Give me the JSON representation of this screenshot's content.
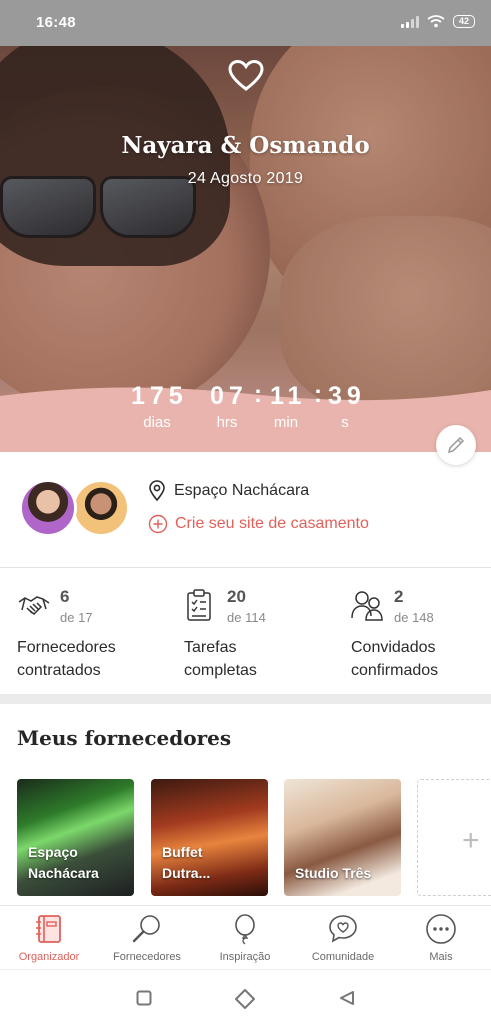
{
  "status_bar": {
    "time": "16:48",
    "battery": "42"
  },
  "hero": {
    "names": "Nayara & Osmando",
    "date": "24 Agosto 2019",
    "countdown": {
      "days": "175",
      "hours": "07",
      "minutes": "11",
      "seconds": "39",
      "days_label": "dias",
      "hours_label": "hrs",
      "minutes_label": "min",
      "seconds_label": "s",
      "separator": ":"
    }
  },
  "info": {
    "venue": "Espaço Nachácara",
    "site_link": "Crie seu site de casamento"
  },
  "stats": [
    {
      "value": "6",
      "total": "de 17",
      "label_line1": "Fornecedores",
      "label_line2": "contratados",
      "icon": "handshake-icon"
    },
    {
      "value": "20",
      "total": "de 114",
      "label_line1": "Tarefas",
      "label_line2": "completas",
      "icon": "checklist-icon"
    },
    {
      "value": "2",
      "total": "de 148",
      "label_line1": "Convidados",
      "label_line2": "confirmados",
      "icon": "guests-icon"
    }
  ],
  "vendors": {
    "title": "Meus fornecedores",
    "items": [
      {
        "line1": "Espaço",
        "line2": "Nachácara"
      },
      {
        "line1": "Buffet",
        "line2": "Dutra..."
      },
      {
        "line1": "Studio Três",
        "line2": ""
      }
    ],
    "add_symbol": "+"
  },
  "bottom_nav": [
    {
      "label": "Organizador",
      "icon": "notebook-icon",
      "active": true
    },
    {
      "label": "Fornecedores",
      "icon": "search-icon",
      "active": false
    },
    {
      "label": "Inspiração",
      "icon": "balloon-icon",
      "active": false
    },
    {
      "label": "Comunidade",
      "icon": "chat-heart-icon",
      "active": false
    },
    {
      "label": "Mais",
      "icon": "more-icon",
      "active": false
    }
  ],
  "colors": {
    "accent": "#e0615a",
    "pink_band": "#eab4ae",
    "status_bar": "#9a9a9a"
  }
}
